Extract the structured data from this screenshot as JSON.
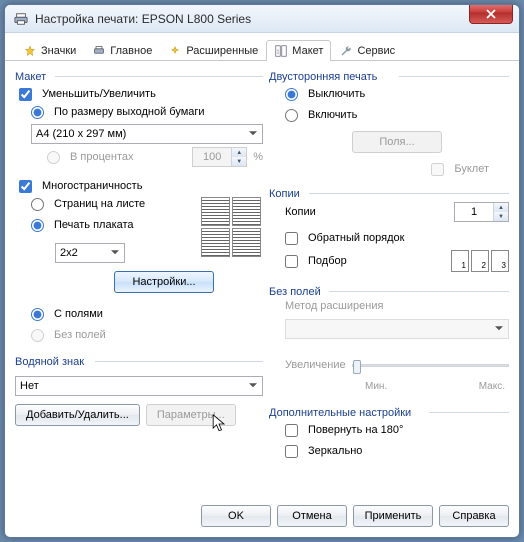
{
  "window": {
    "title": "Настройка печати: EPSON L800 Series"
  },
  "tabs": {
    "shortcuts": "Значки",
    "main": "Главное",
    "advanced": "Расширенные",
    "layout": "Макет",
    "service": "Сервис"
  },
  "layout": {
    "group": "Макет",
    "reduce_enlarge": "Уменьшить/Увеличить",
    "fit_to_page": "По размеру выходной бумаги",
    "paper_size": "A4 (210 x 297 мм)",
    "percent": "В процентах",
    "percent_value": "100",
    "percent_suffix": "%",
    "multipage": "Многостраничность",
    "pages_per_sheet": "Страниц на листе",
    "poster": "Печать плаката",
    "poster_size": "2x2",
    "settings_btn": "Настройки...",
    "with_borders": "С полями",
    "borderless": "Без полей"
  },
  "watermark": {
    "group": "Водяной знак",
    "value": "Нет",
    "add_remove": "Добавить/Удалить...",
    "params": "Параметры..."
  },
  "duplex": {
    "group": "Двусторонняя печать",
    "off": "Выключить",
    "on": "Включить",
    "margins_btn": "Поля...",
    "booklet": "Буклет"
  },
  "copies": {
    "group": "Копии",
    "label": "Копии",
    "value": "1",
    "reverse": "Обратный порядок",
    "collate": "Подбор",
    "pagenums": [
      "1",
      "2",
      "3"
    ]
  },
  "borderless": {
    "group": "Без полей",
    "method": "Метод расширения",
    "enlarge": "Увеличение",
    "min": "Мин.",
    "max": "Макс."
  },
  "extra": {
    "group": "Дополнительные настройки",
    "rotate": "Повернуть на  180°",
    "mirror": "Зеркально"
  },
  "buttons": {
    "ok": "OK",
    "cancel": "Отмена",
    "apply": "Применить",
    "help": "Справка"
  }
}
